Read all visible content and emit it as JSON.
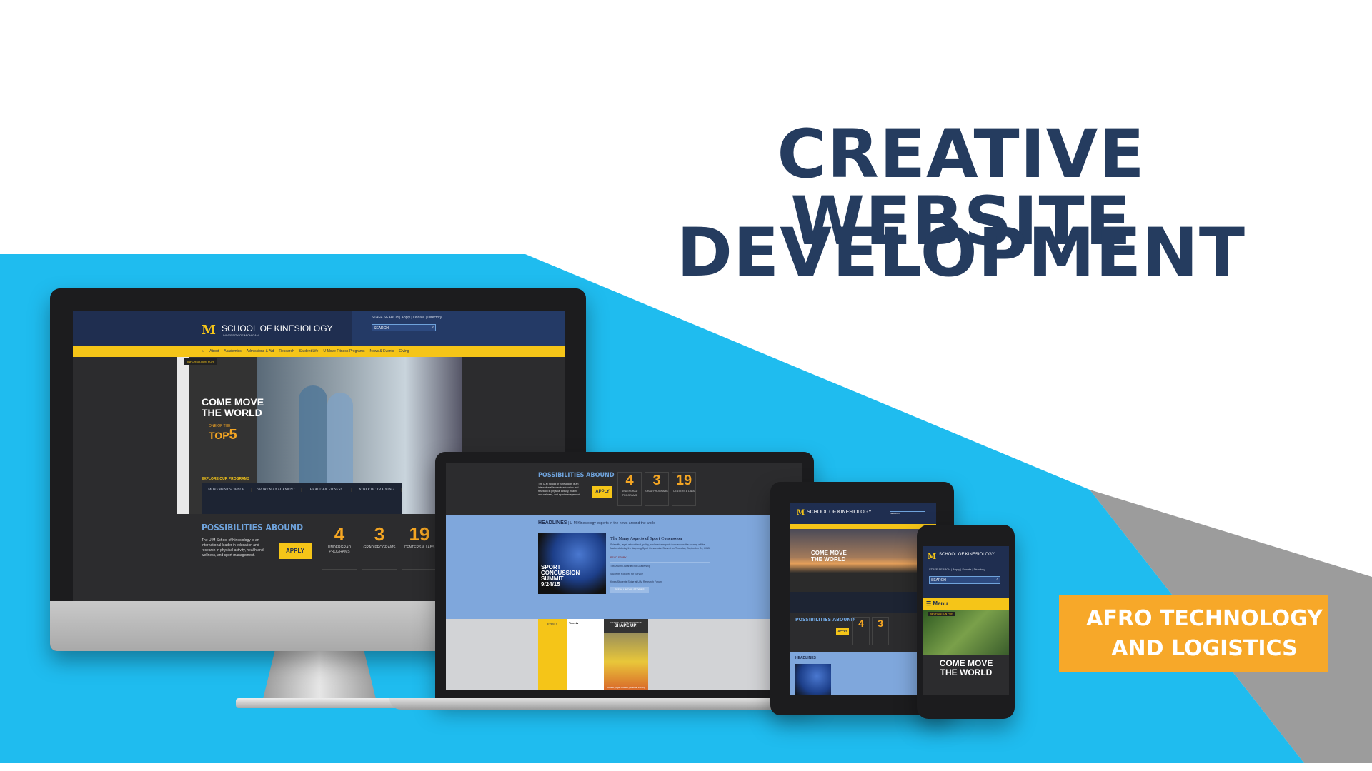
{
  "headline": {
    "line1": "CREATIVE WEBSITE",
    "line2": "DEVELOPMENT"
  },
  "badge": {
    "line1": "AFRO TECHNOLOGY",
    "line2": "AND LOGISTICS"
  },
  "colors": {
    "title": "#253c5f",
    "background_blue": "#1fbcef",
    "accent_orange": "#f7a829",
    "grey": "#9a9a9a",
    "site_navy": "#1f2e50",
    "site_yellow": "#f5c518"
  },
  "site": {
    "school_name": "SCHOOL OF KINESIOLOGY",
    "university": "UNIVERSITY OF MICHIGAN",
    "logo_letter": "M",
    "top_links": "STAFF SEARCH | Apply | Donate | Directory",
    "search_placeholder": "SEARCH",
    "nav": [
      "About",
      "Academics",
      "Admissions & Aid",
      "Research",
      "Student Life",
      "U-Move Fitness Programs",
      "News & Events",
      "Giving"
    ],
    "info_for": "INFORMATION FOR",
    "hero_title_1": "COME MOVE",
    "hero_title_2": "THE WORLD",
    "one_of_the": "ONE OF THE",
    "top": "TOP",
    "five": "5",
    "explore": "EXPLORE OUR PROGRAMS",
    "programs": [
      "MOVEMENT SCIENCE",
      "SPORT MANAGEMENT",
      "HEALTH & FITNESS",
      "ATHLETIC TRAINING"
    ],
    "possibilities": "POSSIBILITIES ABOUND",
    "description": "The U-M School of Kinesiology is an international leader in education and research in physical activity, health and wellness, and sport management.",
    "apply": "APPLY",
    "stats": [
      {
        "value": "4",
        "label": "UNDERGRAD PROGRAMS"
      },
      {
        "value": "3",
        "label": "GRAD PROGRAMS"
      },
      {
        "value": "19",
        "label": "CENTERS & LABS"
      }
    ],
    "headlines": "HEADLINES",
    "headlines_sub": "| U-M Kinesiology experts in the news around the world",
    "summit": [
      "SPORT",
      "CONCUSSION",
      "SUMMIT",
      "9/24/15"
    ],
    "article_title": "The Many Aspects of Sport Concussion",
    "article_body": "Scientific, legal, educational, policy, and media experts from across the country will be featured during the day-long Sport Concussion Summit on Thursday, September 24, 2015.",
    "read_story": "READ STORY",
    "news_items": [
      "Two Alumni Awarded for Leadership",
      "Students Honored for Service",
      "Kines Students Shine at U-M Research Forum"
    ],
    "see_all": "SEE ALL NEWS STORIES",
    "events": "EVENTS",
    "tweets": "Tweets",
    "shape_up_kicker": "U-MOVE FITNESS PROGRAMS",
    "shape_up": "SHAPE UP!",
    "shape_up_caption": "Zumba, yoga, Crossfit, personal training",
    "menu": "Menu"
  }
}
